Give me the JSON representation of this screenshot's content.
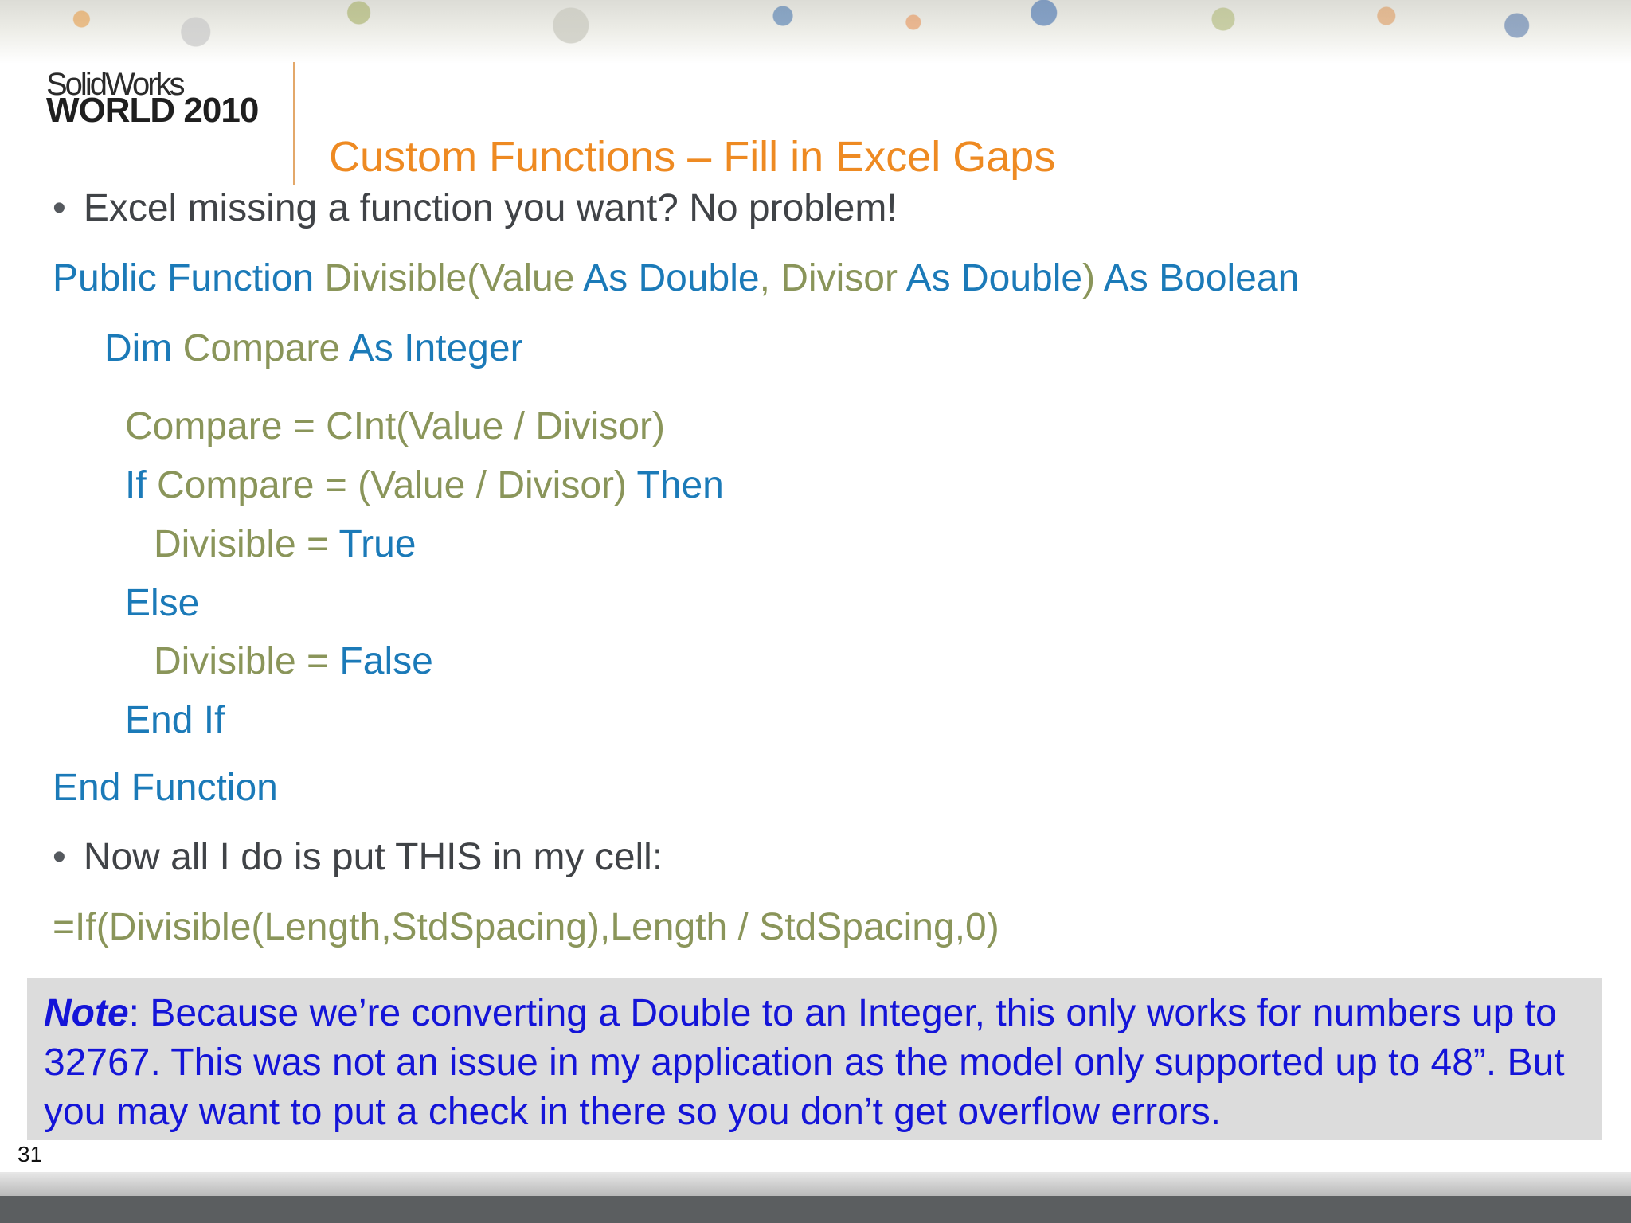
{
  "logo": {
    "line1": "SolidWorks",
    "line2": "WORLD 2010"
  },
  "title": "Custom Functions – Fill in Excel Gaps",
  "bullets": {
    "b1": "Excel missing a function you want? No problem!",
    "b2": "Now all I do is put THIS in my cell:"
  },
  "code": {
    "l1": {
      "kw1": "Public Function",
      "id1": "Divisible(Value",
      "kw2": "As Double",
      "id2": ", Divisor",
      "kw3": "As Double",
      "id3": ")",
      "kw4": "As Boolean"
    },
    "l2": {
      "kw1": "Dim",
      "id1": "Compare",
      "kw2": "As Integer"
    },
    "l3": {
      "id1": "Compare = CInt(Value / Divisor)"
    },
    "l4": {
      "kw1": "If",
      "id1": "Compare = (Value / Divisor)",
      "kw2": "Then"
    },
    "l5": {
      "id1": "Divisible =",
      "kw1": "True"
    },
    "l6": {
      "kw1": "Else"
    },
    "l7": {
      "id1": "Divisible =",
      "kw1": "False"
    },
    "l8": {
      "kw1": "End If"
    },
    "l9": {
      "kw1": "End Function"
    }
  },
  "formula": "=If(Divisible(Length,StdSpacing),Length / StdSpacing,0)",
  "note": {
    "label": "Note",
    "text": ": Because we’re converting a Double to an Integer, this only works for numbers up to 32767. This was not an issue in my application as the model only supported up to 48”. But you may want to put a check in there so you don’t get overflow errors."
  },
  "page_number": "31",
  "colors": {
    "title": "#ee8a22",
    "keyword": "#1b7ab8",
    "identifier": "#8a955a",
    "note_text": "#1414d8",
    "note_bg": "#dcdcdc"
  }
}
